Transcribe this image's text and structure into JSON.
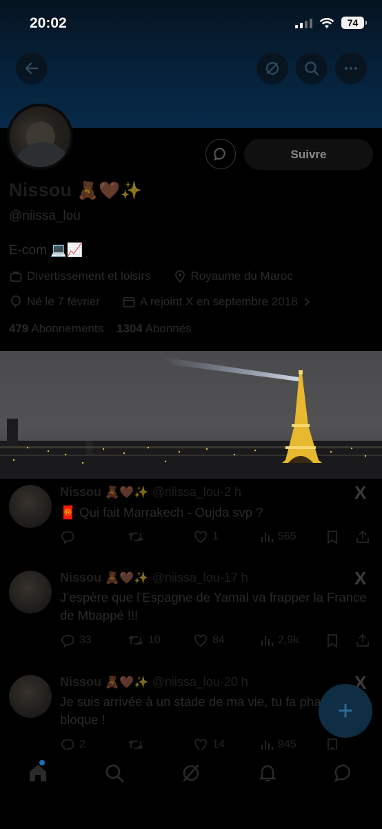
{
  "status": {
    "time": "20:02",
    "battery": "74"
  },
  "header": {
    "back_icon": "arrow-left-icon",
    "grok_icon": "grok-icon",
    "search_icon": "search-icon",
    "more_icon": "more-icon"
  },
  "profile": {
    "name": "Nissou",
    "name_emojis": "🧸🤎✨",
    "handle": "@niissa_lou",
    "bio": "E-com 💻📈",
    "category": "Divertissement et loisirs",
    "location": "Royaume du Maroc",
    "birthday": "Né le 7 février",
    "joined": "A rejoint X en septembre 2018",
    "following_count": "479",
    "following_label": "Abonnements",
    "followers_count": "1304",
    "followers_label": "Abonnés",
    "follow_label": "Suivre"
  },
  "tweets": [
    {
      "name": "Nissou",
      "emojis": "🧸🤎✨",
      "handle": "@niissa_lou",
      "sep": "·",
      "time": "2 h",
      "text": "🧧 Qui fait Marrakech - Oujda svp ?",
      "replies": "",
      "retweets": "",
      "likes": "1",
      "views": "565"
    },
    {
      "name": "Nissou",
      "emojis": "🧸🤎✨",
      "handle": "@niissa_lou",
      "sep": "·",
      "time": "17 h",
      "text": "J’espère que l’Espagne de Yamal va frapper la France de Mbappé !!!",
      "replies": "33",
      "retweets": "10",
      "likes": "84",
      "views": "2,9k"
    },
    {
      "name": "Nissou",
      "emojis": "🧸🤎✨",
      "handle": "@niissa_lou",
      "sep": "·",
      "time": "20 h",
      "text": "Je suis arrivée à un stade de ma vie, tu fa phase, j’te bloque !",
      "replies": "2",
      "retweets": "",
      "likes": "14",
      "views": "945"
    }
  ],
  "x_logo": "X",
  "fab": {
    "label": "+"
  },
  "colors": {
    "accent": "#1d9bf0",
    "banner": "#06213a",
    "background": "#000000"
  }
}
